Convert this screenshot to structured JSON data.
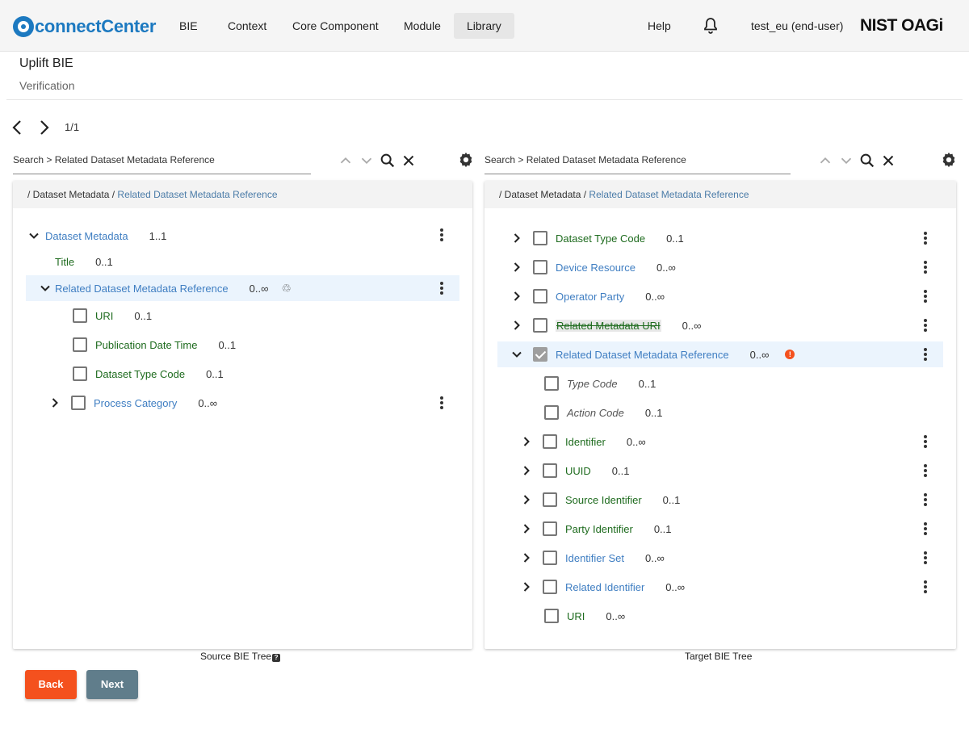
{
  "app": {
    "logo_text": "connectCenter",
    "brand": "NIST OAGi",
    "accent": "#1c79c0"
  },
  "nav": {
    "items": [
      {
        "label": "BIE"
      },
      {
        "label": "Context"
      },
      {
        "label": "Core Component"
      },
      {
        "label": "Module"
      },
      {
        "label": "Library",
        "active": true
      }
    ],
    "help": "Help",
    "bell_icon": "bell-icon",
    "user": "test_eu (end-user)"
  },
  "header": {
    "title": "Uplift BIE",
    "subtitle": "Verification"
  },
  "pager": {
    "text": "1/1"
  },
  "source": {
    "search": "Search > Related Dataset Metadata Reference",
    "crumb_root": "/ Dataset Metadata /",
    "crumb_link": "Related Dataset Metadata Reference",
    "caption": "Source BIE Tree",
    "caption_badge": "?",
    "rows": [
      {
        "label": "Dataset Metadata",
        "card": "1..1"
      },
      {
        "label": "Title",
        "card": "0..1"
      },
      {
        "label": "Related Dataset Metadata Reference",
        "card": "0..∞"
      },
      {
        "label": "URI",
        "card": "0..1"
      },
      {
        "label": "Publication Date Time",
        "card": "0..1"
      },
      {
        "label": "Dataset Type Code",
        "card": "0..1"
      },
      {
        "label": "Process Category",
        "card": "0..∞"
      }
    ]
  },
  "target": {
    "search": "Search > Related Dataset Metadata Reference",
    "crumb_root": "/ Dataset Metadata /",
    "crumb_link": "Related Dataset Metadata Reference",
    "caption": "Target BIE Tree",
    "warn_glyph": "!",
    "rows": [
      {
        "label": "Dataset Type Code",
        "card": "0..1"
      },
      {
        "label": "Device Resource",
        "card": "0..∞"
      },
      {
        "label": "Operator Party",
        "card": "0..∞"
      },
      {
        "label": "Related Metadata URI",
        "card": "0..∞"
      },
      {
        "label": "Related Dataset Metadata Reference",
        "card": "0..∞"
      },
      {
        "label": "Type Code",
        "card": "0..1"
      },
      {
        "label": "Action Code",
        "card": "0..1"
      },
      {
        "label": "Identifier",
        "card": "0..∞"
      },
      {
        "label": "UUID",
        "card": "0..1"
      },
      {
        "label": "Source Identifier",
        "card": "0..1"
      },
      {
        "label": "Party Identifier",
        "card": "0..1"
      },
      {
        "label": "Identifier Set",
        "card": "0..∞"
      },
      {
        "label": "Related Identifier",
        "card": "0..∞"
      },
      {
        "label": "URI",
        "card": "0..∞"
      }
    ]
  },
  "buttons": {
    "back": "Back",
    "next": "Next",
    "back_color": "#f4511e",
    "next_color": "#607d8b"
  }
}
